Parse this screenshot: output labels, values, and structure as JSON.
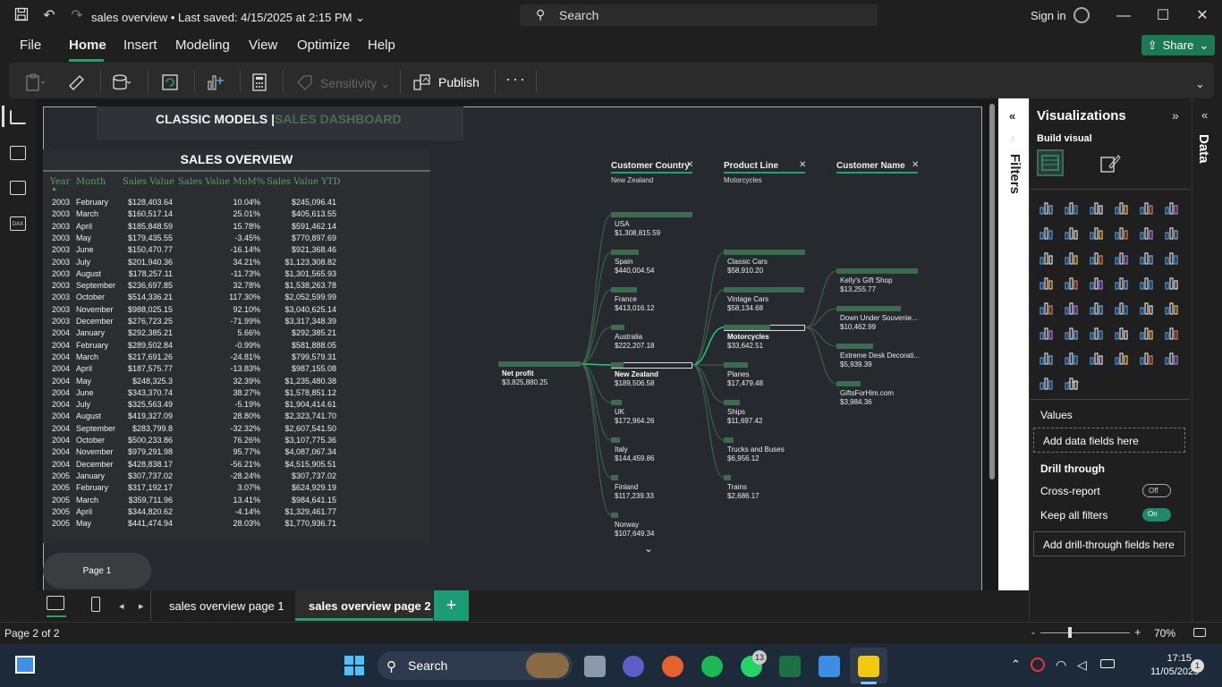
{
  "titlebar": {
    "file_title": "sales overview",
    "last_saved": "Last saved: 4/15/2025 at 2:15 PM",
    "search_label": "Search",
    "signin": "Sign in"
  },
  "menu": {
    "file": "File",
    "home": "Home",
    "insert": "Insert",
    "modeling": "Modeling",
    "view": "View",
    "optimize": "Optimize",
    "help": "Help",
    "share": "Share"
  },
  "ribbon": {
    "sensitivity": "Sensitivity",
    "publish": "Publish",
    "more": "···"
  },
  "dashboard": {
    "title_main": "CLASSIC MODELS |",
    "title_accent": "SALES DASHBOARD",
    "overview_title": "SALES OVERVIEW",
    "columns": [
      "Year",
      "Month",
      "Sales Value",
      "Sales Value MoM%",
      "Sales Value YTD"
    ],
    "rows": [
      [
        "2003",
        "February",
        "$128,403.64",
        "10.04%",
        "$245,096.41"
      ],
      [
        "2003",
        "March",
        "$160,517.14",
        "25.01%",
        "$405,613.55"
      ],
      [
        "2003",
        "April",
        "$185,848.59",
        "15.78%",
        "$591,462.14"
      ],
      [
        "2003",
        "May",
        "$179,435.55",
        "-3.45%",
        "$770,897.69"
      ],
      [
        "2003",
        "June",
        "$150,470.77",
        "-16.14%",
        "$921,368.46"
      ],
      [
        "2003",
        "July",
        "$201,940.36",
        "34.21%",
        "$1,123,308.82"
      ],
      [
        "2003",
        "August",
        "$178,257.11",
        "-11.73%",
        "$1,301,565.93"
      ],
      [
        "2003",
        "September",
        "$236,697.85",
        "32.78%",
        "$1,538,263.78"
      ],
      [
        "2003",
        "October",
        "$514,336.21",
        "117.30%",
        "$2,052,599.99"
      ],
      [
        "2003",
        "November",
        "$988,025.15",
        "92.10%",
        "$3,040,625.14"
      ],
      [
        "2003",
        "December",
        "$276,723.25",
        "-71.99%",
        "$3,317,348.39"
      ],
      [
        "2004",
        "January",
        "$292,385.21",
        "5.66%",
        "$292,385.21"
      ],
      [
        "2004",
        "February",
        "$289,502.84",
        "-0.99%",
        "$581,888.05"
      ],
      [
        "2004",
        "March",
        "$217,691.26",
        "-24.81%",
        "$799,579.31"
      ],
      [
        "2004",
        "April",
        "$187,575.77",
        "-13.83%",
        "$987,155.08"
      ],
      [
        "2004",
        "May",
        "$248,325.3",
        "32.39%",
        "$1,235,480.38"
      ],
      [
        "2004",
        "June",
        "$343,370.74",
        "38.27%",
        "$1,578,851.12"
      ],
      [
        "2004",
        "July",
        "$325,563.49",
        "-5.19%",
        "$1,904,414.61"
      ],
      [
        "2004",
        "August",
        "$419,327.09",
        "28.80%",
        "$2,323,741.70"
      ],
      [
        "2004",
        "September",
        "$283,799.8",
        "-32.32%",
        "$2,607,541.50"
      ],
      [
        "2004",
        "October",
        "$500,233.86",
        "76.26%",
        "$3,107,775.36"
      ],
      [
        "2004",
        "November",
        "$979,291.98",
        "95.77%",
        "$4,087,067.34"
      ],
      [
        "2004",
        "December",
        "$428,838.17",
        "-56.21%",
        "$4,515,905.51"
      ],
      [
        "2005",
        "January",
        "$307,737.02",
        "-28.24%",
        "$307,737.02"
      ],
      [
        "2005",
        "February",
        "$317,192.17",
        "3.07%",
        "$624,929.19"
      ],
      [
        "2005",
        "March",
        "$359,711.96",
        "13.41%",
        "$984,641.15"
      ],
      [
        "2005",
        "April",
        "$344,820.62",
        "-4.14%",
        "$1,329,461.77"
      ],
      [
        "2005",
        "May",
        "$441,474.94",
        "28.03%",
        "$1,770,936.71"
      ]
    ],
    "page_button": "Page 1"
  },
  "decomp_tree": {
    "levels": [
      {
        "header": "Customer Country",
        "selected": "New Zealand"
      },
      {
        "header": "Product Line",
        "selected": "Motorcycles"
      },
      {
        "header": "Customer Name",
        "selected": ""
      }
    ],
    "root": {
      "name": "Net profit",
      "value": "$3,825,880.25"
    },
    "countries": [
      {
        "name": "USA",
        "value": "$1,308,815.59",
        "share": 1.0
      },
      {
        "name": "Spain",
        "value": "$440,004.54",
        "share": 0.34
      },
      {
        "name": "France",
        "value": "$413,016.12",
        "share": 0.32
      },
      {
        "name": "Australia",
        "value": "$222,207.18",
        "share": 0.17
      },
      {
        "name": "New Zealand",
        "value": "$189,506.58",
        "share": 0.15,
        "selected": true
      },
      {
        "name": "UK",
        "value": "$172,964.26",
        "share": 0.13
      },
      {
        "name": "Italy",
        "value": "$144,459.86",
        "share": 0.11
      },
      {
        "name": "Finland",
        "value": "$117,239.33",
        "share": 0.09
      },
      {
        "name": "Norway",
        "value": "$107,649.34",
        "share": 0.08
      }
    ],
    "products": [
      {
        "name": "Classic Cars",
        "value": "$58,910.20",
        "share": 1.0
      },
      {
        "name": "Vintage Cars",
        "value": "$58,134.68",
        "share": 0.99
      },
      {
        "name": "Motorcycles",
        "value": "$33,642.51",
        "share": 0.57,
        "selected": true
      },
      {
        "name": "Planes",
        "value": "$17,479.48",
        "share": 0.3
      },
      {
        "name": "Ships",
        "value": "$11,697.42",
        "share": 0.2
      },
      {
        "name": "Trucks and Buses",
        "value": "$6,956.12",
        "share": 0.12
      },
      {
        "name": "Trains",
        "value": "$2,686.17",
        "share": 0.05
      }
    ],
    "customers": [
      {
        "name": "Kelly's Gift Shop",
        "value": "$13,255.77",
        "share": 1.0
      },
      {
        "name": "Down Under Souvenie...",
        "value": "$10,462.99",
        "share": 0.79
      },
      {
        "name": "Extreme Desk Decorati...",
        "value": "$5,939.39",
        "share": 0.45
      },
      {
        "name": "GiftsForHim.com",
        "value": "$3,984.36",
        "share": 0.3
      }
    ]
  },
  "panes": {
    "filters": "Filters",
    "visualizations": "Visualizations",
    "build_visual": "Build visual",
    "values": "Values",
    "add_data_fields": "Add data fields here",
    "drill_through": "Drill through",
    "cross_report": "Cross-report",
    "cross_report_state": "Off",
    "keep_all_filters": "Keep all filters",
    "keep_all_filters_state": "On",
    "add_drill_fields": "Add drill-through fields here",
    "data": "Data"
  },
  "tabs": [
    "sales overview page 1",
    "sales overview page 2"
  ],
  "status": {
    "page_count": "Page 2 of 2",
    "zoom": "70%"
  },
  "taskbar": {
    "search": "Search",
    "whatsapp_badge": "13",
    "time": "17:15",
    "date": "11/05/2025",
    "notif": "1"
  }
}
